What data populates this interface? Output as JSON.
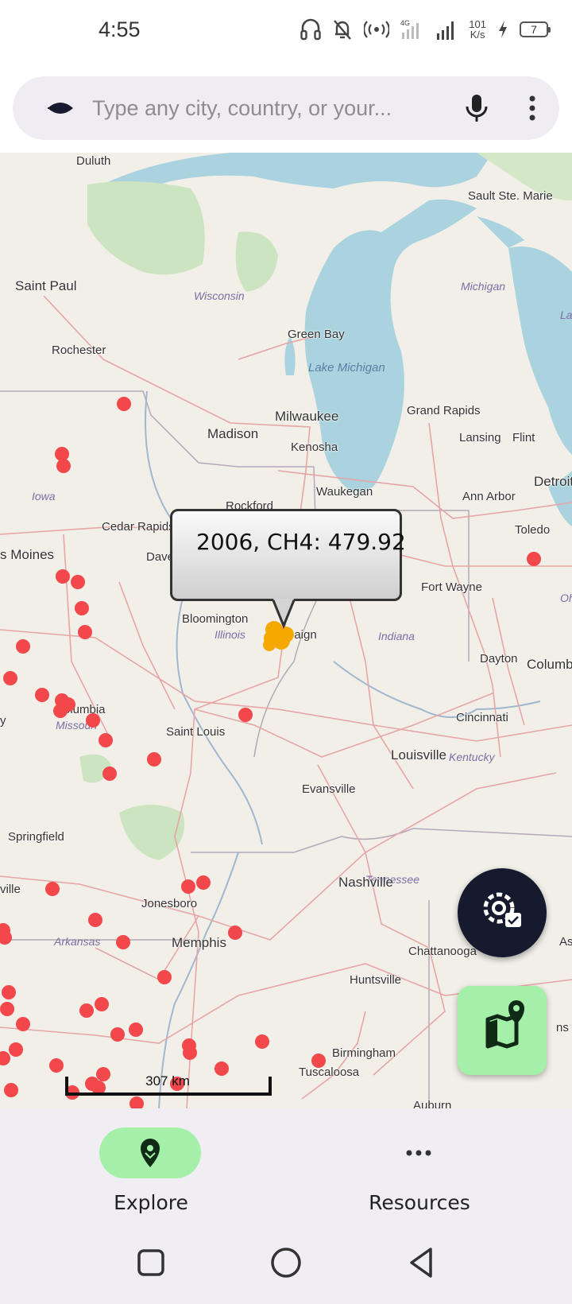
{
  "status_bar": {
    "time": "4:55",
    "network_type": "4G",
    "net_speed_value": "101",
    "net_speed_unit": "K/s",
    "battery_level": "7",
    "icons": [
      "headphones-icon",
      "bell-off-icon",
      "hotspot-icon",
      "signal-4g-icon",
      "signal-icon",
      "charging-icon",
      "battery-icon"
    ]
  },
  "search": {
    "placeholder": "Type any city, country, or your...",
    "value": "",
    "logo_icon": "app-logo-icon",
    "mic_icon": "mic-icon",
    "more_icon": "more-vert-icon"
  },
  "map": {
    "popup_text": "2006, CH4: 479.92",
    "scale_label": "307 km",
    "marker_color": "#f2474b",
    "selected_marker_color": "#f5a800",
    "cities": {
      "duluth": "Duluth",
      "saint_paul": "Saint Paul",
      "rochester": "Rochester",
      "madison": "Madison",
      "green_bay": "Green Bay",
      "milwaukee": "Milwaukee",
      "kenosha": "Kenosha",
      "waukegan": "Waukegan",
      "rockford": "Rockford",
      "grand_rapids": "Grand Rapids",
      "lansing": "Lansing",
      "flint": "Flint",
      "detroit": "Detroit",
      "ann_arbor": "Ann Arbor",
      "toledo": "Toledo",
      "sault_ste_marie": "Sault Ste. Marie",
      "cedar_rapids": "Cedar Rapids",
      "des_moines": "s Moines",
      "davenport": "Dave",
      "bloomington": "Bloomington",
      "champaign": "paign",
      "fort_wayne": "Fort Wayne",
      "dayton": "Dayton",
      "columbus": "Columb",
      "columbia": "olumbia",
      "saint_louis": "Saint Louis",
      "cincinnati": "Cincinnati",
      "louisville": "Louisville",
      "evansville": "Evansville",
      "springfield": "Springfield",
      "nashville": "Nashville",
      "jonesboro": "Jonesboro",
      "memphis": "Memphis",
      "chattanooga": "Chattanooga",
      "huntsville": "Huntsville",
      "birmingham": "Birmingham",
      "tuscaloosa": "Tuscaloosa",
      "auburn": "Auburn",
      "ville": "ville",
      "y": "y",
      "as": "As",
      "ns": "ns"
    },
    "states": {
      "wisconsin": "Wisconsin",
      "michigan": "Michigan",
      "iowa": "Iowa",
      "illinois": "Illinois",
      "indiana": "Indiana",
      "ohio": "Oh",
      "missouri": "Missouri",
      "kentucky": "Kentucky",
      "tennessee": "Tennessee",
      "arkansas": "Arkansas",
      "la": "La"
    },
    "lakes": {
      "lake_michigan": "Lake Michigan"
    }
  },
  "fabs": {
    "settings_icon": "settings-check-icon",
    "map_icon": "map-pin-icon"
  },
  "bottom_nav": {
    "items": [
      {
        "label": "Explore",
        "icon": "location-pin-icon",
        "active": true
      },
      {
        "label": "Resources",
        "icon": "more-horiz-icon",
        "active": false
      }
    ]
  },
  "system_nav": {
    "icons": [
      "recent-apps-icon",
      "home-icon",
      "back-icon"
    ]
  }
}
